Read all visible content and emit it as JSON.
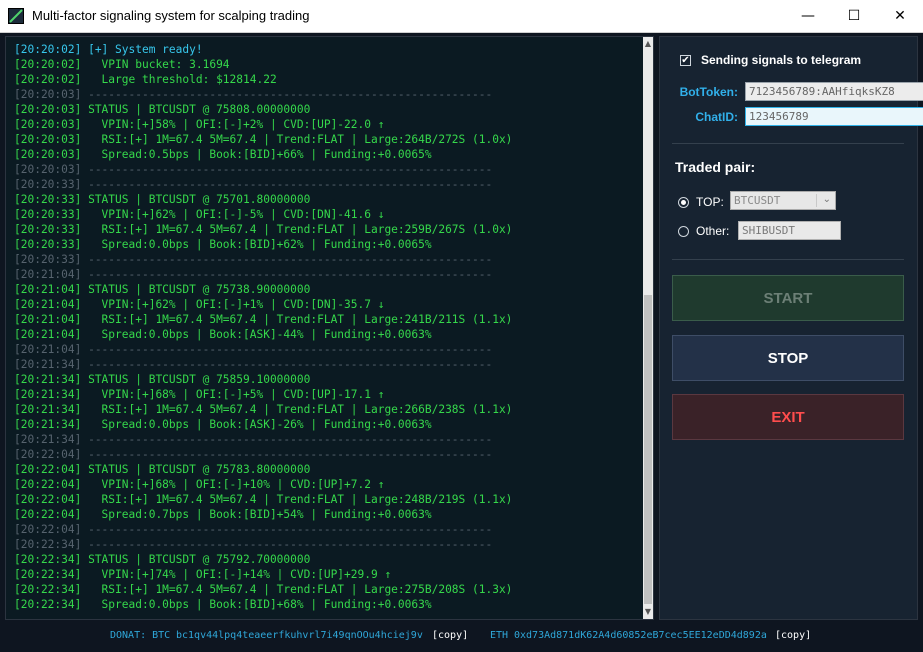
{
  "window": {
    "title": "Multi-factor signaling system for scalping trading",
    "minimize": "—",
    "maximize": "☐",
    "close": "✕"
  },
  "log": [
    {
      "text": "[20:20:02] [+] System ready!",
      "style": "cyan"
    },
    {
      "text": "[20:20:02]   VPIN bucket: 3.1694",
      "style": "green"
    },
    {
      "text": "[20:20:02]   Large threshold: $12814.22",
      "style": "green"
    },
    {
      "text": "[20:20:03] ------------------------------------------------------------",
      "style": "gray"
    },
    {
      "text": "[20:20:03] STATUS | BTCUSDT @ 75808.00000000",
      "style": "green"
    },
    {
      "text": "[20:20:03]   VPIN:[+]58% | OFI:[-]+2% | CVD:[UP]-22.0 ↑",
      "style": "green"
    },
    {
      "text": "[20:20:03]   RSI:[+] 1M=67.4 5M=67.4 | Trend:FLAT | Large:264B/272S (1.0x)",
      "style": "green"
    },
    {
      "text": "[20:20:03]   Spread:0.5bps | Book:[BID]+66% | Funding:+0.0065%",
      "style": "green"
    },
    {
      "text": "[20:20:03] ------------------------------------------------------------",
      "style": "gray"
    },
    {
      "text": "[20:20:33] ------------------------------------------------------------",
      "style": "gray"
    },
    {
      "text": "[20:20:33] STATUS | BTCUSDT @ 75701.80000000",
      "style": "green"
    },
    {
      "text": "[20:20:33]   VPIN:[+]62% | OFI:[-]-5% | CVD:[DN]-41.6 ↓",
      "style": "green"
    },
    {
      "text": "[20:20:33]   RSI:[+] 1M=67.4 5M=67.4 | Trend:FLAT | Large:259B/267S (1.0x)",
      "style": "green"
    },
    {
      "text": "[20:20:33]   Spread:0.0bps | Book:[BID]+62% | Funding:+0.0065%",
      "style": "green"
    },
    {
      "text": "[20:20:33] ------------------------------------------------------------",
      "style": "gray"
    },
    {
      "text": "[20:21:04] ------------------------------------------------------------",
      "style": "gray"
    },
    {
      "text": "[20:21:04] STATUS | BTCUSDT @ 75738.90000000",
      "style": "green"
    },
    {
      "text": "[20:21:04]   VPIN:[+]62% | OFI:[-]+1% | CVD:[DN]-35.7 ↓",
      "style": "green"
    },
    {
      "text": "[20:21:04]   RSI:[+] 1M=67.4 5M=67.4 | Trend:FLAT | Large:241B/211S (1.1x)",
      "style": "green"
    },
    {
      "text": "[20:21:04]   Spread:0.0bps | Book:[ASK]-44% | Funding:+0.0063%",
      "style": "green"
    },
    {
      "text": "[20:21:04] ------------------------------------------------------------",
      "style": "gray"
    },
    {
      "text": "[20:21:34] ------------------------------------------------------------",
      "style": "gray"
    },
    {
      "text": "[20:21:34] STATUS | BTCUSDT @ 75859.10000000",
      "style": "green"
    },
    {
      "text": "[20:21:34]   VPIN:[+]68% | OFI:[-]+5% | CVD:[UP]-17.1 ↑",
      "style": "green"
    },
    {
      "text": "[20:21:34]   RSI:[+] 1M=67.4 5M=67.4 | Trend:FLAT | Large:266B/238S (1.1x)",
      "style": "green"
    },
    {
      "text": "[20:21:34]   Spread:0.0bps | Book:[ASK]-26% | Funding:+0.0063%",
      "style": "green"
    },
    {
      "text": "[20:21:34] ------------------------------------------------------------",
      "style": "gray"
    },
    {
      "text": "[20:22:04] ------------------------------------------------------------",
      "style": "gray"
    },
    {
      "text": "[20:22:04] STATUS | BTCUSDT @ 75783.80000000",
      "style": "green"
    },
    {
      "text": "[20:22:04]   VPIN:[+]68% | OFI:[-]+10% | CVD:[UP]+7.2 ↑",
      "style": "green"
    },
    {
      "text": "[20:22:04]   RSI:[+] 1M=67.4 5M=67.4 | Trend:FLAT | Large:248B/219S (1.1x)",
      "style": "green"
    },
    {
      "text": "[20:22:04]   Spread:0.7bps | Book:[BID]+54% | Funding:+0.0063%",
      "style": "green"
    },
    {
      "text": "[20:22:04] ------------------------------------------------------------",
      "style": "gray"
    },
    {
      "text": "[20:22:34] ------------------------------------------------------------",
      "style": "gray"
    },
    {
      "text": "[20:22:34] STATUS | BTCUSDT @ 75792.70000000",
      "style": "green"
    },
    {
      "text": "[20:22:34]   VPIN:[+]74% | OFI:[-]+14% | CVD:[UP]+29.9 ↑",
      "style": "green"
    },
    {
      "text": "[20:22:34]   RSI:[+] 1M=67.4 5M=67.4 | Trend:FLAT | Large:275B/208S (1.3x)",
      "style": "green"
    },
    {
      "text": "[20:22:34]   Spread:0.0bps | Book:[BID]+68% | Funding:+0.0063%",
      "style": "green"
    }
  ],
  "settings": {
    "telegram_checkbox_label": "Sending signals to telegram",
    "telegram_checked": true,
    "bot_token_label": "BotToken:",
    "bot_token_value": "7123456789:AAHfiqksKZ8",
    "chat_id_label": "ChatID:",
    "chat_id_value": "123456789",
    "traded_pair_title": "Traded pair:",
    "top_label": "TOP:",
    "top_selected": "BTCUSDT",
    "other_label": "Other:",
    "other_value": "SHIBUSDT"
  },
  "buttons": {
    "start": "START",
    "stop": "STOP",
    "exit": "EXIT"
  },
  "footer": {
    "donat_label": "DONAT: BTC",
    "btc_address": "bc1qv44lpq4teaeerfkuhvrl7i49qnOOu4hciej9v",
    "copy_label": "[copy]",
    "eth_label": "ETH",
    "eth_address": "0xd73Ad871dK62A4d60852eB7cec5EE12eDD4d892a"
  },
  "colors": {
    "green": "#35d84b",
    "cyan": "#37c7ec",
    "gray": "#56636e",
    "accent": "#31b0ea",
    "exit": "#ff4d4d"
  }
}
